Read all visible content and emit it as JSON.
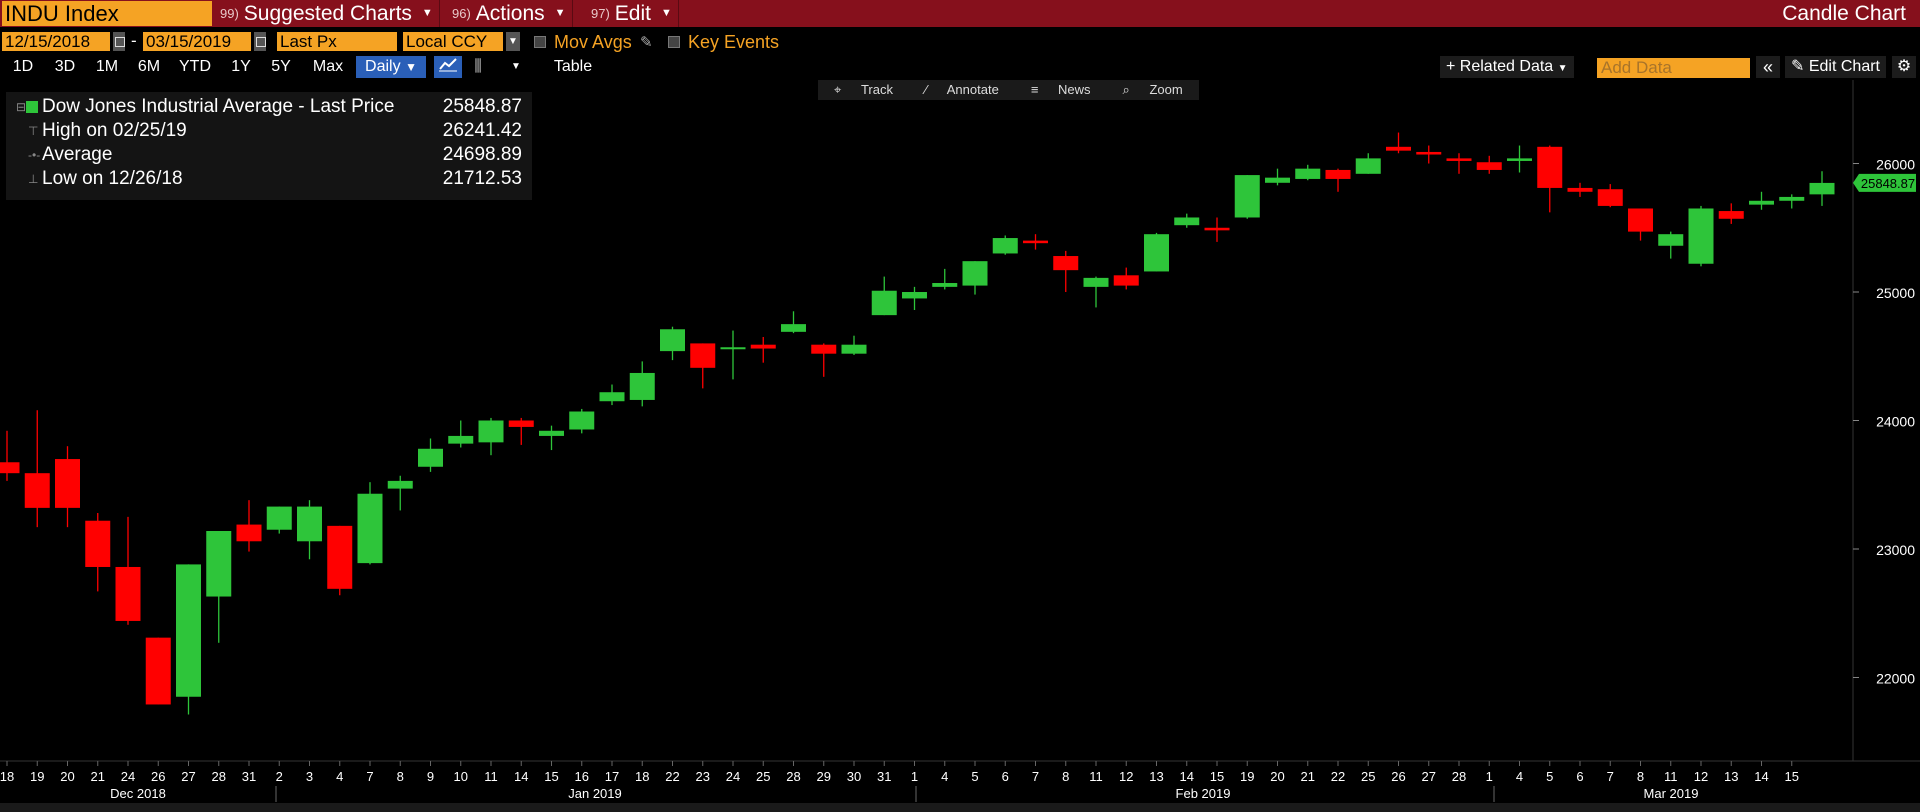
{
  "titlebar": {
    "ticker": "INDU Index",
    "menus": [
      {
        "num": "99)",
        "label": "Suggested Charts"
      },
      {
        "num": "96)",
        "label": "Actions"
      },
      {
        "num": "97)",
        "label": "Edit"
      }
    ],
    "chart_type": "Candle Chart"
  },
  "controls": {
    "start_date": "12/15/2018",
    "end_date": "03/15/2019",
    "date_sep": "-",
    "price_field": "Last Px",
    "currency": "Local CCY",
    "mov_avgs": "Mov Avgs",
    "key_events": "Key Events"
  },
  "ranges": [
    "1D",
    "3D",
    "1M",
    "6M",
    "YTD",
    "1Y",
    "5Y",
    "Max"
  ],
  "frequency": "Daily",
  "table_label": "Table",
  "related_data": "Related Data",
  "add_data_placeholder": "Add Data",
  "edit_chart": "Edit Chart",
  "chart_tools": [
    "Track",
    "Annotate",
    "News",
    "Zoom"
  ],
  "legend": {
    "title": "Dow Jones Industrial Average - Last Price",
    "last": "25848.87",
    "high_label": "High on 02/25/19",
    "high": "26241.42",
    "avg_label": "Average",
    "avg": "24698.89",
    "low_label": "Low on 12/26/18",
    "low": "21712.53"
  },
  "colors": {
    "up": "#2ec53a",
    "down": "#ff0000",
    "accent": "#f5a324",
    "titlebar": "#86101c"
  },
  "chart_data": {
    "type": "candlestick",
    "title": "Dow Jones Industrial Average - Last Price",
    "ylim": [
      21350,
      26650
    ],
    "yticks": [
      22000,
      23000,
      24000,
      25000,
      26000
    ],
    "last_price_label": "25848.87",
    "month_labels": [
      "Dec 2018",
      "Jan 2019",
      "Feb 2019",
      "Mar 2019"
    ],
    "dates": [
      "18",
      "19",
      "20",
      "21",
      "24",
      "26",
      "27",
      "28",
      "31",
      "2",
      "3",
      "4",
      "7",
      "8",
      "9",
      "10",
      "11",
      "14",
      "15",
      "16",
      "17",
      "18",
      "22",
      "23",
      "24",
      "25",
      "28",
      "29",
      "30",
      "31",
      "1",
      "4",
      "5",
      "6",
      "7",
      "8",
      "11",
      "12",
      "13",
      "14",
      "15",
      "19",
      "20",
      "21",
      "22",
      "25",
      "26",
      "27",
      "28",
      "1",
      "4",
      "5",
      "6",
      "7",
      "8",
      "11",
      "12",
      "13",
      "14",
      "15"
    ],
    "candles": [
      {
        "o": 23675,
        "h": 23920,
        "l": 23530,
        "c": 23590
      },
      {
        "o": 23590,
        "h": 24080,
        "l": 23170,
        "c": 23320
      },
      {
        "o": 23700,
        "h": 23800,
        "l": 23170,
        "c": 23320
      },
      {
        "o": 23220,
        "h": 23280,
        "l": 22670,
        "c": 22860
      },
      {
        "o": 22860,
        "h": 23250,
        "l": 22410,
        "c": 22440
      },
      {
        "o": 22310,
        "h": 22310,
        "l": 21790,
        "c": 21790
      },
      {
        "o": 21850,
        "h": 22880,
        "l": 21712,
        "c": 22880
      },
      {
        "o": 22630,
        "h": 23140,
        "l": 22270,
        "c": 23140
      },
      {
        "o": 23190,
        "h": 23380,
        "l": 22980,
        "c": 23060
      },
      {
        "o": 23150,
        "h": 23330,
        "l": 23120,
        "c": 23330
      },
      {
        "o": 23060,
        "h": 23380,
        "l": 22920,
        "c": 23330
      },
      {
        "o": 23180,
        "h": 23180,
        "l": 22640,
        "c": 22690
      },
      {
        "o": 22890,
        "h": 23520,
        "l": 22880,
        "c": 23430
      },
      {
        "o": 23470,
        "h": 23570,
        "l": 23300,
        "c": 23530
      },
      {
        "o": 23640,
        "h": 23860,
        "l": 23600,
        "c": 23780
      },
      {
        "o": 23820,
        "h": 24000,
        "l": 23790,
        "c": 23880
      },
      {
        "o": 23830,
        "h": 24020,
        "l": 23730,
        "c": 24000
      },
      {
        "o": 24000,
        "h": 24020,
        "l": 23810,
        "c": 23950
      },
      {
        "o": 23880,
        "h": 23960,
        "l": 23770,
        "c": 23920
      },
      {
        "o": 23930,
        "h": 24090,
        "l": 23900,
        "c": 24070
      },
      {
        "o": 24150,
        "h": 24280,
        "l": 24120,
        "c": 24220
      },
      {
        "o": 24160,
        "h": 24460,
        "l": 24110,
        "c": 24370
      },
      {
        "o": 24540,
        "h": 24730,
        "l": 24470,
        "c": 24710
      },
      {
        "o": 24600,
        "h": 24600,
        "l": 24250,
        "c": 24410
      },
      {
        "o": 24570,
        "h": 24700,
        "l": 24320,
        "c": 24570
      },
      {
        "o": 24590,
        "h": 24650,
        "l": 24450,
        "c": 24560
      },
      {
        "o": 24690,
        "h": 24850,
        "l": 24680,
        "c": 24750
      },
      {
        "o": 24590,
        "h": 24600,
        "l": 24340,
        "c": 24520
      },
      {
        "o": 24520,
        "h": 24660,
        "l": 24510,
        "c": 24590
      },
      {
        "o": 24820,
        "h": 25120,
        "l": 24820,
        "c": 25010
      },
      {
        "o": 24950,
        "h": 25040,
        "l": 24860,
        "c": 25000
      },
      {
        "o": 25040,
        "h": 25180,
        "l": 25020,
        "c": 25070
      },
      {
        "o": 25050,
        "h": 25240,
        "l": 24980,
        "c": 25240
      },
      {
        "o": 25300,
        "h": 25440,
        "l": 25290,
        "c": 25420
      },
      {
        "o": 25400,
        "h": 25450,
        "l": 25330,
        "c": 25380
      },
      {
        "o": 25280,
        "h": 25320,
        "l": 25000,
        "c": 25170
      },
      {
        "o": 25040,
        "h": 25120,
        "l": 24880,
        "c": 25110
      },
      {
        "o": 25130,
        "h": 25190,
        "l": 25020,
        "c": 25050
      },
      {
        "o": 25160,
        "h": 25460,
        "l": 25160,
        "c": 25450
      },
      {
        "o": 25520,
        "h": 25610,
        "l": 25500,
        "c": 25580
      },
      {
        "o": 25500,
        "h": 25580,
        "l": 25390,
        "c": 25480
      },
      {
        "o": 25580,
        "h": 25910,
        "l": 25570,
        "c": 25910
      },
      {
        "o": 25850,
        "h": 25960,
        "l": 25830,
        "c": 25890
      },
      {
        "o": 25880,
        "h": 25990,
        "l": 25870,
        "c": 25960
      },
      {
        "o": 25950,
        "h": 25960,
        "l": 25780,
        "c": 25880
      },
      {
        "o": 25920,
        "h": 26080,
        "l": 25920,
        "c": 26040
      },
      {
        "o": 26130,
        "h": 26241,
        "l": 26080,
        "c": 26100
      },
      {
        "o": 26090,
        "h": 26140,
        "l": 26000,
        "c": 26070
      },
      {
        "o": 26040,
        "h": 26080,
        "l": 25920,
        "c": 26020
      },
      {
        "o": 26010,
        "h": 26060,
        "l": 25920,
        "c": 25950
      },
      {
        "o": 26020,
        "h": 26140,
        "l": 25930,
        "c": 26040
      },
      {
        "o": 26130,
        "h": 26140,
        "l": 25620,
        "c": 25810
      },
      {
        "o": 25810,
        "h": 25850,
        "l": 25740,
        "c": 25780
      },
      {
        "o": 25800,
        "h": 25840,
        "l": 25660,
        "c": 25670
      },
      {
        "o": 25650,
        "h": 25650,
        "l": 25400,
        "c": 25470
      },
      {
        "o": 25360,
        "h": 25470,
        "l": 25260,
        "c": 25450
      },
      {
        "o": 25220,
        "h": 25670,
        "l": 25200,
        "c": 25650
      },
      {
        "o": 25630,
        "h": 25690,
        "l": 25530,
        "c": 25570
      },
      {
        "o": 25680,
        "h": 25780,
        "l": 25640,
        "c": 25710
      },
      {
        "o": 25710,
        "h": 25760,
        "l": 25650,
        "c": 25740
      },
      {
        "o": 25760,
        "h": 25940,
        "l": 25670,
        "c": 25849
      }
    ]
  }
}
